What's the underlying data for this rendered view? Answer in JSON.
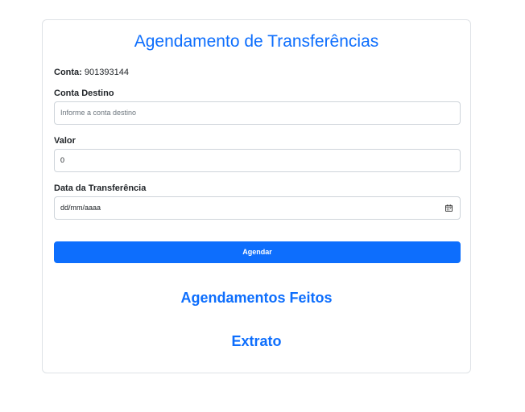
{
  "form": {
    "title": "Agendamento de Transferências",
    "conta_label": "Conta:",
    "conta_value": "901393144",
    "conta_destino_label": "Conta Destino",
    "conta_destino_placeholder": "Informe a conta destino",
    "valor_label": "Valor",
    "valor_value": "0",
    "data_label": "Data da Transferência",
    "data_placeholder": "dd/mm/aaaa",
    "submit_label": "Agendar"
  },
  "sections": {
    "agendamentos": "Agendamentos Feitos",
    "extrato": "Extrato"
  },
  "colors": {
    "primary": "#0d6efd",
    "border": "#dee2e6"
  },
  "icons": {
    "date_picker": "calendar-icon"
  }
}
